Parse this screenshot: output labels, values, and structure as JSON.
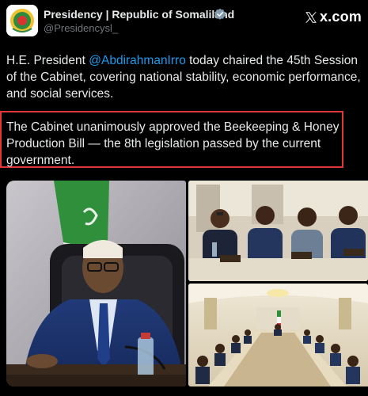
{
  "account": {
    "name": "Presidency | Republic of Somaliland",
    "handle": "@Presidencysl_",
    "verified": true
  },
  "brand": {
    "text": "x.com",
    "icon": "x-logo-icon"
  },
  "post": {
    "intro": "H.E. President ",
    "mention": "@AbdirahmanIrro",
    "rest": " today chaired the 45th Session of the Cabinet, covering national stability, economic performance, and social services.",
    "highlight": "The Cabinet unanimously approved the Beekeeping & Honey Production Bill — the 8th legislation passed by the current government."
  },
  "colors": {
    "background": "#000000",
    "text": "#e7e9ea",
    "muted": "#71767b",
    "link": "#1d9bf0",
    "highlight_border": "#e0373b"
  },
  "media": [
    {
      "name": "president-portrait-photo"
    },
    {
      "name": "cabinet-members-photo"
    },
    {
      "name": "cabinet-hall-photo"
    }
  ]
}
